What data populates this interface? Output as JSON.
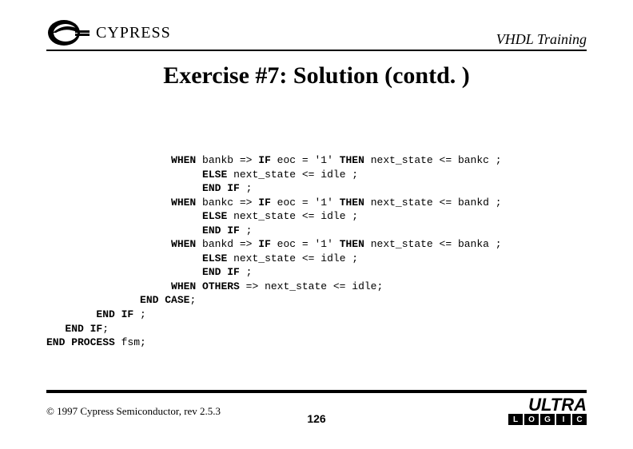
{
  "header": {
    "brand": "CYPRESS",
    "right": "VHDL Training"
  },
  "title": "Exercise #7: Solution (contd. )",
  "code": {
    "l1a": "WHEN",
    "l1b": " bankb => ",
    "l1c": "IF",
    "l1d": " eoc = '1' ",
    "l1e": "THEN",
    "l1f": " next_state <= bankc ;",
    "l2a": "ELSE",
    "l2b": " next_state <= idle ;",
    "l3a": "END IF",
    "l3b": " ;",
    "l4a": "WHEN",
    "l4b": " bankc => ",
    "l4c": "IF",
    "l4d": " eoc = '1' ",
    "l4e": "THEN",
    "l4f": " next_state <= bankd ;",
    "l5a": "ELSE",
    "l5b": " next_state <= idle ;",
    "l6a": "END IF",
    "l6b": " ;",
    "l7a": "WHEN",
    "l7b": " bankd => ",
    "l7c": "IF",
    "l7d": " eoc = '1' ",
    "l7e": "THEN",
    "l7f": " next_state <= banka ;",
    "l8a": "ELSE",
    "l8b": " next_state <= idle ;",
    "l9a": "END IF",
    "l9b": " ;",
    "l10a": "WHEN OTHERS",
    "l10b": " => next_state <= idle;",
    "l11a": "END CASE",
    "l11b": ";",
    "l12a": "END IF",
    "l12b": " ;",
    "l13a": "END IF",
    "l13b": ";",
    "l14a": "END PROCESS",
    "l14b": " fsm;"
  },
  "footer": {
    "copyright": "© 1997 Cypress Semiconductor, rev 2.5.3",
    "page": "126",
    "ultra": "ULTRA",
    "squares": [
      "L",
      "O",
      "G",
      "I",
      "C"
    ]
  }
}
